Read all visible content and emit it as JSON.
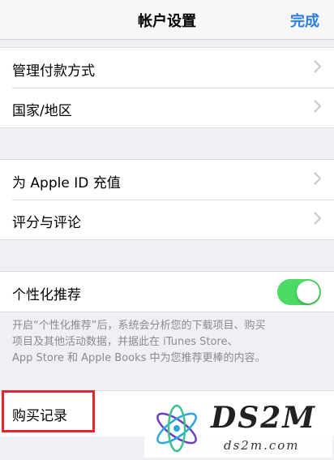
{
  "navbar": {
    "title": "帐户设置",
    "done_label": "完成"
  },
  "group1": {
    "items": [
      {
        "label": "管理付款方式"
      },
      {
        "label": "国家/地区"
      }
    ]
  },
  "group2": {
    "items": [
      {
        "label": "为 Apple ID 充值"
      },
      {
        "label": "评分与评论"
      }
    ]
  },
  "personalization": {
    "label": "个性化推荐",
    "enabled": true,
    "note_lines": [
      "开启“个性化推荐”后，系统会分析您的下载项目、购买",
      "项目及其他活动数据，并据此在 iTunes Store、",
      "App Store 和 Apple Books 中为您推荐更棒的内容。"
    ]
  },
  "purchase_history": {
    "label": "购买记录"
  },
  "watermark": {
    "brand": "DS2M",
    "url": "ds2m.com"
  },
  "colors": {
    "accent": "#2f7de1",
    "toggle_on": "#4cd964",
    "highlight": "#e0282e"
  }
}
